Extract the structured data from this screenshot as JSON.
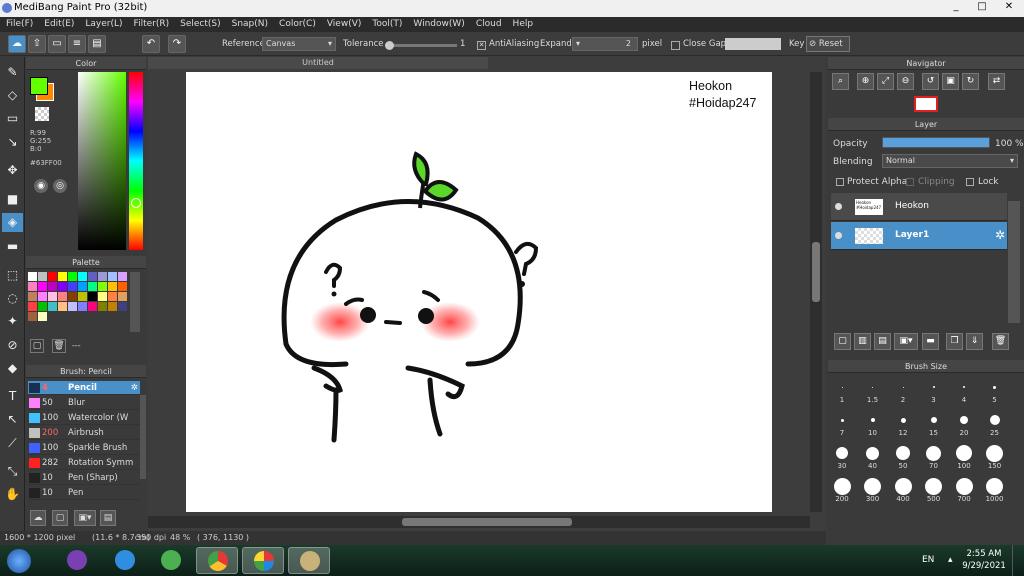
{
  "window": {
    "title": "MediBang Paint Pro (32bit)",
    "min": "_",
    "max": "□",
    "close": "✕"
  },
  "menu": [
    "File(F)",
    "Edit(E)",
    "Layer(L)",
    "Filter(R)",
    "Select(S)",
    "Snap(N)",
    "Color(C)",
    "View(V)",
    "Tool(T)",
    "Window(W)",
    "Cloud",
    "Help"
  ],
  "toolbar": {
    "reference_label": "Reference",
    "reference_value": "Canvas",
    "tolerance_label": "Tolerance",
    "tolerance_value": "1",
    "antialiasing_label": "AntiAliasing",
    "expand_label": "Expand",
    "expand_value": "2",
    "expand_unit": "pixel",
    "close_gaps_label": "Close Gaps",
    "key_label": "Key",
    "reset_label": "Reset"
  },
  "color_panel": {
    "title": "Color",
    "r": "R:99",
    "g": "G:255",
    "b": "B:0",
    "hex": "#63FF00",
    "fg_color": "#63FF00",
    "bg_color": "#FF8800"
  },
  "palette_panel": {
    "title": "Palette",
    "colors": [
      "#ffffff",
      "#c0c0c0",
      "#ff0000",
      "#ffff00",
      "#00ff00",
      "#00ffff",
      "#6060c0",
      "#9b9bd8",
      "#a0c0ff",
      "#d8a0ff",
      "#ff80c0",
      "#ff00ff",
      "#c000c0",
      "#8000ff",
      "#4040ff",
      "#00a0ff",
      "#00ff80",
      "#80ff00",
      "#ffc000",
      "#ff6000",
      "#c08060",
      "#ff80ff",
      "#ffc0e0",
      "#ff8080",
      "#804000",
      "#c0c000",
      "#000000",
      "#ffff80",
      "#ff8040",
      "#e0a060",
      "#ff4040",
      "#00c000",
      "#40c0c0",
      "#ffc080",
      "#c0c0ff",
      "#8080ff",
      "#ff0080",
      "#808000",
      "#c08000",
      "#404080",
      "#a06040",
      "#ffffc0"
    ],
    "name": "---"
  },
  "brush_panel": {
    "title": "Brush: Pencil",
    "items": [
      {
        "size": "4",
        "name": "Pencil",
        "color": "#1a3050"
      },
      {
        "size": "50",
        "name": "Blur",
        "color": "#ff80ff"
      },
      {
        "size": "100",
        "name": "Watercolor (W",
        "color": "#40c0ff"
      },
      {
        "size": "200",
        "name": "Airbrush",
        "color": "#c0c0c0"
      },
      {
        "size": "100",
        "name": "Sparkle Brush",
        "color": "#4060ff"
      },
      {
        "size": "282",
        "name": "Rotation Symm",
        "color": "#ff2020"
      },
      {
        "size": "10",
        "name": "Pen (Sharp)",
        "color": "#222222"
      },
      {
        "size": "10",
        "name": "Pen",
        "color": "#222222"
      }
    ]
  },
  "document": {
    "tab": "Untitled",
    "text_line1": "Heokon",
    "text_line2": "#Hoidap247"
  },
  "status": {
    "size": "1600 * 1200 pixel",
    "cm": "(11.6 * 8.7cm)",
    "dpi": "350 dpi",
    "zoom": "48 %",
    "coords": "( 376, 1130 )"
  },
  "navigator": {
    "title": "Navigator"
  },
  "layer_panel": {
    "title": "Layer",
    "opacity_label": "Opacity",
    "opacity_value": "100 %",
    "opacity_fraction": 1.0,
    "blending_label": "Blending",
    "blending_value": "Normal",
    "protect_alpha": "Protect Alpha",
    "clipping": "Clipping",
    "lock": "Lock",
    "layers": [
      {
        "name": "Heokon",
        "thumb": "Heokon\n#Hoidap247"
      },
      {
        "name": "Layer1"
      }
    ]
  },
  "brush_size_panel": {
    "title": "Brush Size",
    "sizes": [
      "1",
      "1.5",
      "2",
      "3",
      "4",
      "5",
      "7",
      "10",
      "12",
      "15",
      "20",
      "25",
      "30",
      "40",
      "50",
      "70",
      "100",
      "150",
      "200",
      "300",
      "400",
      "500",
      "700",
      "1000"
    ]
  },
  "taskbar": {
    "lang": "EN",
    "time": "2:55 AM",
    "date": "9/29/2021"
  }
}
